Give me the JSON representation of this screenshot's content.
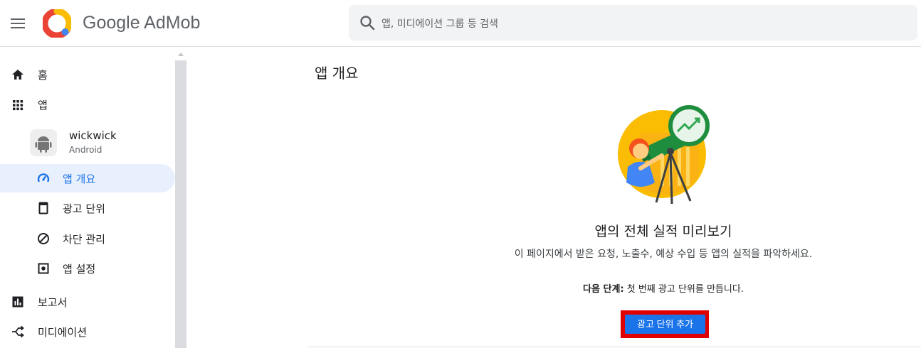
{
  "header": {
    "brand": "Google AdMob",
    "search_placeholder": "앱, 미디에이션 그룹 등 검색",
    "colors": {
      "logo_red": "#ea4335",
      "logo_yellow": "#fbbc04",
      "logo_blue": "#4285f4"
    }
  },
  "sidebar": {
    "items": [
      {
        "label": "홈",
        "icon": "home-icon"
      },
      {
        "label": "앱",
        "icon": "apps-grid-icon"
      },
      {
        "label": "앱 개요",
        "icon": "gauge-icon",
        "active": true
      },
      {
        "label": "광고 단위",
        "icon": "ad-unit-icon"
      },
      {
        "label": "차단 관리",
        "icon": "block-icon"
      },
      {
        "label": "앱 설정",
        "icon": "settings-icon"
      },
      {
        "label": "보고서",
        "icon": "bar-chart-icon"
      },
      {
        "label": "미디에이션",
        "icon": "mediation-icon"
      }
    ],
    "app": {
      "name": "wickwick",
      "platform": "Android",
      "icon": "android-icon"
    }
  },
  "main": {
    "title": "앱 개요",
    "headline": "앱의 전체 실적 미리보기",
    "description": "이 페이지에서 받은 요청, 노출수, 예상 수입 등 앱의 실적을 파악하세요.",
    "next_step_label": "다음 단계:",
    "next_step_text": " 첫 번째 광고 단위를 만듭니다.",
    "cta_label": "광고 단위 추가",
    "accent_color": "#1a73e8",
    "highlight_color": "#e00000"
  }
}
